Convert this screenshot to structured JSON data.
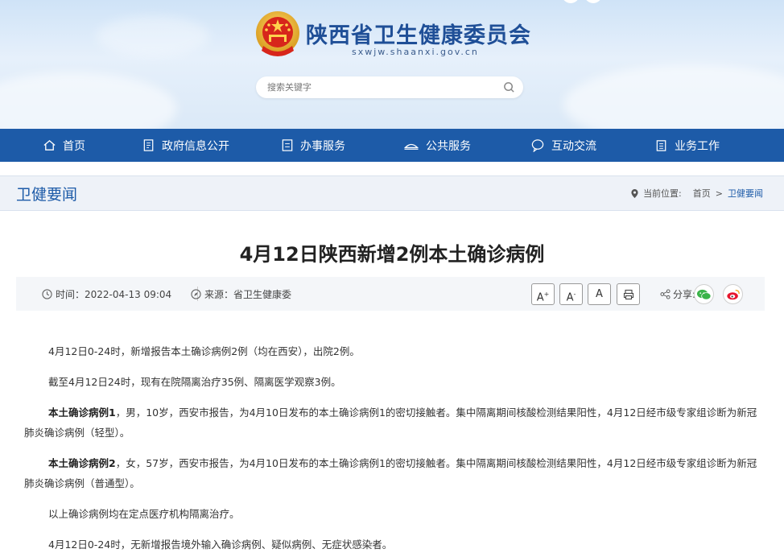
{
  "header": {
    "site_title": "陕西省卫生健康委员会",
    "site_domain": "sxwjw.shaanxi.gov.cn",
    "search_placeholder": "搜索关键字"
  },
  "nav": {
    "items": [
      {
        "label": "首页",
        "icon": "home-icon"
      },
      {
        "label": "政府信息公开",
        "icon": "document-icon"
      },
      {
        "label": "办事服务",
        "icon": "form-icon"
      },
      {
        "label": "公共服务",
        "icon": "service-icon"
      },
      {
        "label": "互动交流",
        "icon": "chat-icon"
      },
      {
        "label": "业务工作",
        "icon": "work-icon"
      }
    ]
  },
  "section": {
    "title": "卫健要闻",
    "breadcrumb_label": "当前位置:",
    "breadcrumb": [
      "首页",
      "卫健要闻"
    ]
  },
  "article": {
    "title": "4月12日陕西新增2例本土确诊病例",
    "time_label": "时间：",
    "time": "2022-04-13 09:04",
    "source_label": "来源：",
    "source": "省卫生健康委",
    "font_large": "A",
    "font_small": "A",
    "font_normal": "A",
    "share_label": "分享:",
    "paragraphs": [
      {
        "lead": "",
        "text": "4月12日0-24时，新增报告本土确诊病例2例（均在西安），出院2例。"
      },
      {
        "lead": "",
        "text": "截至4月12日24时，现有在院隔离治疗35例、隔离医学观察3例。"
      },
      {
        "lead": "本土确诊病例1",
        "text": "，男，10岁，西安市报告，为4月10日发布的本土确诊病例1的密切接触者。集中隔离期间核酸检测结果阳性，4月12日经市级专家组诊断为新冠肺炎确诊病例（轻型）。"
      },
      {
        "lead": "本土确诊病例2",
        "text": "，女，57岁，西安市报告，为4月10日发布的本土确诊病例1的密切接触者。集中隔离期间核酸检测结果阳性，4月12日经市级专家组诊断为新冠肺炎确诊病例（普通型）。"
      },
      {
        "lead": "",
        "text": "以上确诊病例均在定点医疗机构隔离治疗。"
      },
      {
        "lead": "",
        "text": "4月12日0-24时，无新增报告境外输入确诊病例、疑似病例、无症状感染者。"
      }
    ]
  },
  "colors": {
    "nav_bg": "#1d5ba8",
    "title_blue": "#1f4f97",
    "wechat_green": "#3bb34a",
    "weibo_red": "#e6162d"
  }
}
